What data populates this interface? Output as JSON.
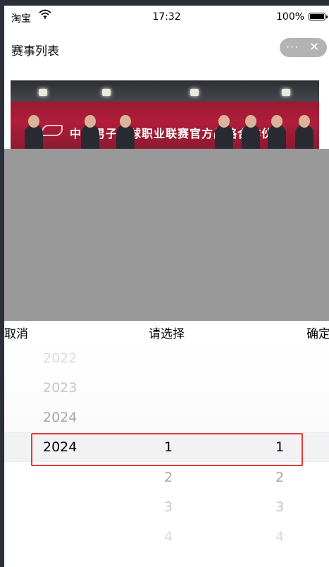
{
  "status_bar": {
    "carrier": "淘宝",
    "time": "17:32",
    "battery": "100%"
  },
  "nav": {
    "title": "赛事列表",
    "more": "···",
    "close": "✕"
  },
  "banner": {
    "headline": "中国男子篮球职业联赛官方战略合作伙伴"
  },
  "picker": {
    "cancel": "取消",
    "title": "请选择",
    "confirm": "确定",
    "years": [
      "2022",
      "2023",
      "2024",
      "2024"
    ],
    "months": [
      "1",
      "2",
      "3",
      "4"
    ],
    "days": [
      "1",
      "2",
      "3",
      "4"
    ]
  },
  "colors": {
    "mask": "#999999",
    "highlight": "#e53935",
    "capsule": "#b3b3b3"
  }
}
